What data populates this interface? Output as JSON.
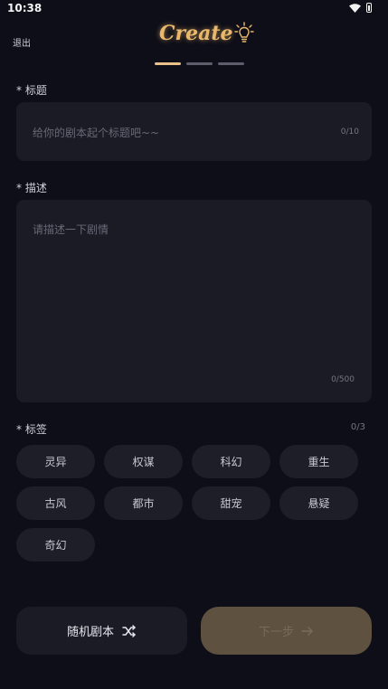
{
  "status_bar": {
    "time": "10:38"
  },
  "header": {
    "exit_label": "退出",
    "logo_text": "Create",
    "steps": [
      "active",
      "inactive",
      "inactive"
    ]
  },
  "title_field": {
    "label": "* 标题",
    "placeholder": "给你的剧本起个标题吧~~",
    "counter": "0/10"
  },
  "desc_field": {
    "label": "* 描述",
    "placeholder": "请描述一下剧情",
    "counter": "0/500"
  },
  "tags": {
    "label": "* 标签",
    "counter": "0/3",
    "items": [
      "灵异",
      "权谋",
      "科幻",
      "重生",
      "古风",
      "都市",
      "甜宠",
      "悬疑",
      "奇幻"
    ]
  },
  "footer": {
    "random_label": "随机剧本",
    "next_label": "下一步"
  },
  "colors": {
    "background": "#0e0e18",
    "accent": "#e9b86c",
    "field": "#1b1b26"
  }
}
